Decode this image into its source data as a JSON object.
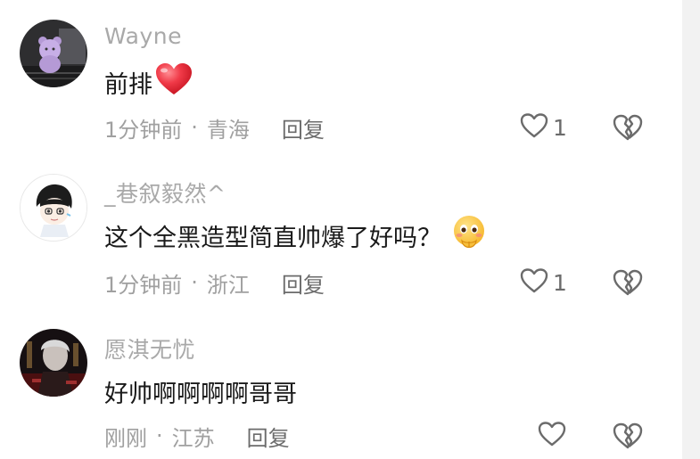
{
  "comments": [
    {
      "username": "Wayne",
      "text": "前排",
      "emoji": "red-heart",
      "time": "1分钟前",
      "location": "青海",
      "reply_label": "回复",
      "like_count": "1"
    },
    {
      "username": "_巷叙毅然^",
      "text": "这个全黑造型简直帅爆了好吗？",
      "emoji": "blushing-face-with-hands",
      "time": "1分钟前",
      "location": "浙江",
      "reply_label": "回复",
      "like_count": "1"
    },
    {
      "username": "愿淇无忧",
      "text": "好帅啊啊啊啊哥哥",
      "time": "刚刚",
      "location": "江苏",
      "reply_label": "回复",
      "like_count": ""
    }
  ],
  "separator": "·",
  "colors": {
    "username": "#a9a9a9",
    "content": "#1a1a1a",
    "meta": "#a0a0a0",
    "heart": "#ee2a3c"
  }
}
